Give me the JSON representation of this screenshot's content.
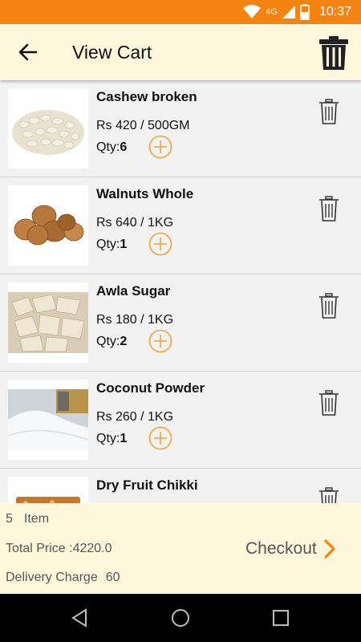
{
  "status_bar": {
    "network": "4G",
    "time": "10:37"
  },
  "app_bar": {
    "title": "View Cart",
    "back_icon": "arrow-left-icon",
    "clear_icon": "trash-icon"
  },
  "cart": {
    "items": [
      {
        "name": "Cashew broken",
        "price_line": "Rs 420  /  500GM",
        "qty_prefix": "Qty:",
        "qty": "6"
      },
      {
        "name": "Walnuts Whole",
        "price_line": "Rs 640  /  1KG",
        "qty_prefix": "Qty:",
        "qty": "1"
      },
      {
        "name": "Awla Sugar",
        "price_line": "Rs 180  /  1KG",
        "qty_prefix": "Qty:",
        "qty": "2"
      },
      {
        "name": "Coconut Powder",
        "price_line": "Rs 260  /  1KG",
        "qty_prefix": "Qty:",
        "qty": "1"
      },
      {
        "name": "Dry Fruit Chikki",
        "price_line": "",
        "qty_prefix": "",
        "qty": ""
      }
    ]
  },
  "summary": {
    "item_count": "5",
    "item_label": "Item",
    "total_price": "Total Price :4220.0",
    "delivery_label": "Delivery Charge",
    "delivery_value": "60",
    "checkout_label": "Checkout"
  },
  "colors": {
    "accent": "#f5830f",
    "header_bg": "#fff7dc",
    "plus_icon": "#f5a23a"
  }
}
